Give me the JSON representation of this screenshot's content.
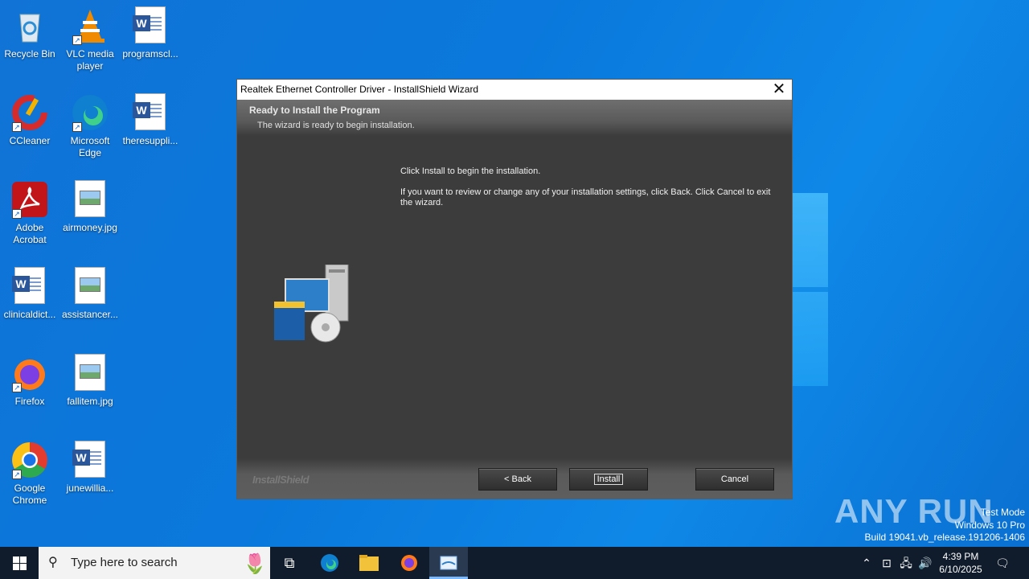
{
  "desktop": {
    "icons": [
      {
        "label": "Recycle Bin"
      },
      {
        "label": "VLC media player"
      },
      {
        "label": "programscl..."
      },
      {
        "label": "CCleaner"
      },
      {
        "label": "Microsoft Edge"
      },
      {
        "label": "theresuppli..."
      },
      {
        "label": "Adobe Acrobat"
      },
      {
        "label": "airmoney.jpg"
      },
      {
        "label": "clinicaldict..."
      },
      {
        "label": "assistancer..."
      },
      {
        "label": "Firefox"
      },
      {
        "label": "fallitem.jpg"
      },
      {
        "label": "Google Chrome"
      },
      {
        "label": "junewillia..."
      }
    ]
  },
  "dialog": {
    "title": "Realtek Ethernet Controller Driver - InstallShield Wizard",
    "header_title": "Ready to Install the Program",
    "header_subtitle": "The wizard is ready to begin installation.",
    "message1": "Click Install to begin the installation.",
    "message2": "If you want to review or change any of your installation settings, click Back. Click Cancel to exit the wizard.",
    "brand": "InstallShield",
    "back_label": "< Back",
    "install_label": "Install",
    "cancel_label": "Cancel"
  },
  "watermark": {
    "brand": "ANY RUN",
    "line1": "Test Mode",
    "line2": "Windows 10 Pro",
    "line3": "Build 19041.vb_release.191206-1406"
  },
  "taskbar": {
    "search_placeholder": "Type here to search",
    "time": "4:39 PM",
    "date": "6/10/2025"
  }
}
